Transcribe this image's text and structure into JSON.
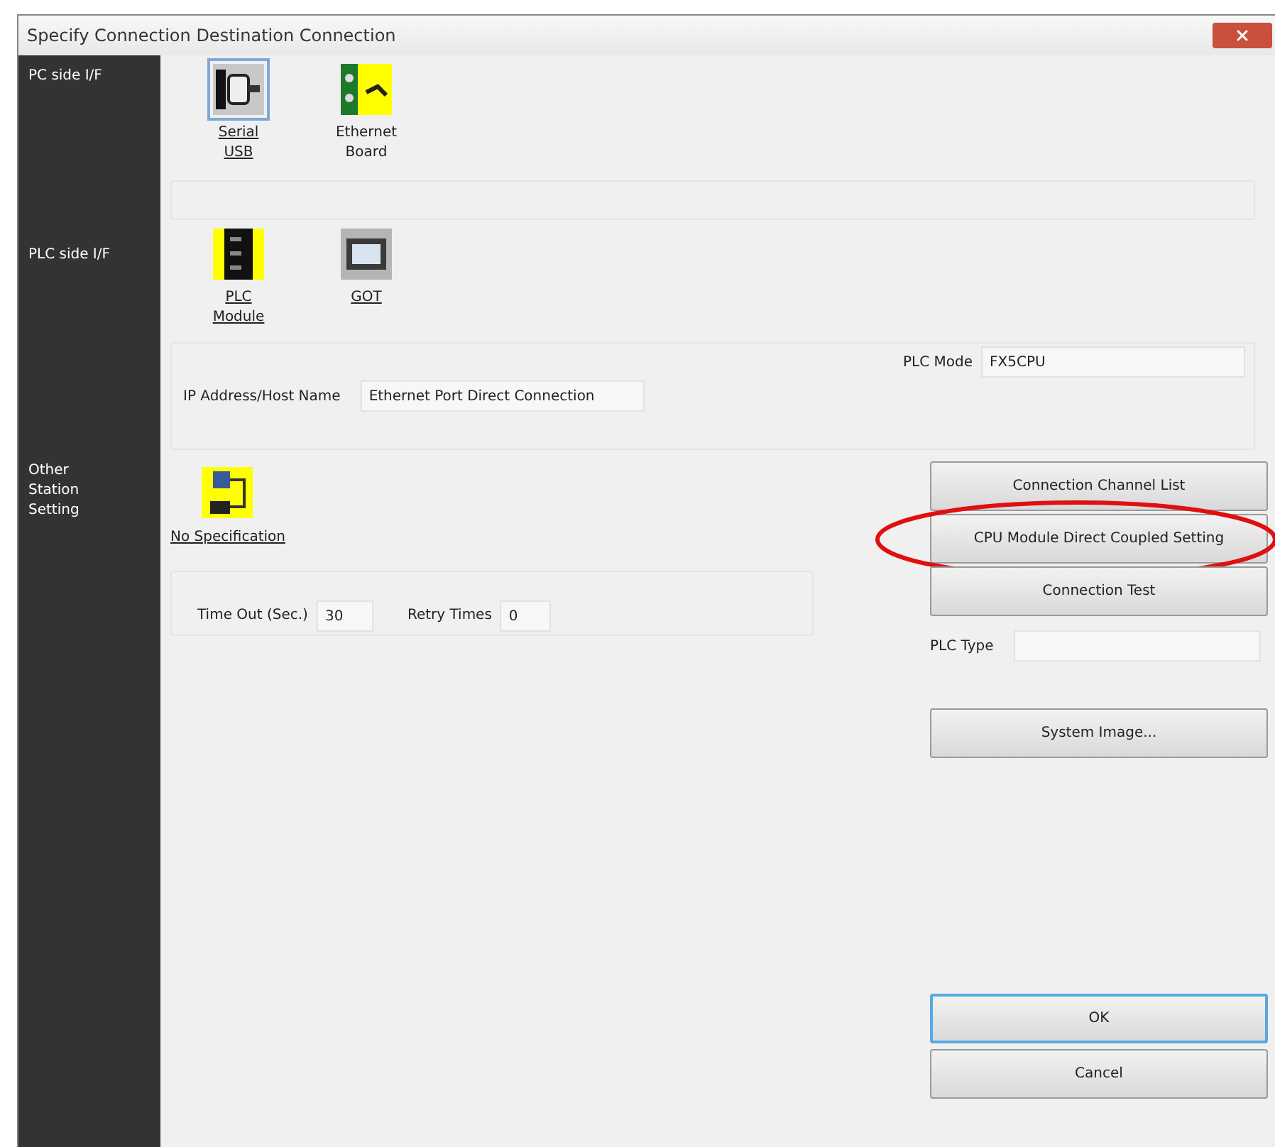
{
  "window": {
    "title": "Specify Connection Destination Connection"
  },
  "sidebar": {
    "sections": [
      "PC side I/F",
      "PLC side I/F",
      "Other Station Setting"
    ]
  },
  "pc_side": {
    "options": [
      {
        "kind": "serial",
        "label": "Serial USB",
        "selected": true,
        "link": true
      },
      {
        "kind": "ethernet",
        "label": "Ethernet Board",
        "selected": false,
        "link": false
      }
    ]
  },
  "plc_side": {
    "options": [
      {
        "kind": "plc",
        "label": "PLC Module",
        "selected": false,
        "link": true
      },
      {
        "kind": "got",
        "label": "GOT",
        "selected": false,
        "link": true
      }
    ],
    "plc_mode": {
      "label": "PLC Mode",
      "value": "FX5CPU"
    },
    "ip_address": {
      "label": "IP Address/Host Name",
      "value": "Ethernet Port Direct Connection"
    }
  },
  "other_station": {
    "option": {
      "kind": "station",
      "label": "No Specification",
      "link": true
    },
    "timeout": {
      "label": "Time Out (Sec.)",
      "value": "30"
    },
    "retry": {
      "label": "Retry Times",
      "value": "0"
    }
  },
  "buttons": [
    {
      "label": "Connection Channel List",
      "default": false,
      "highlighted": false
    },
    {
      "label": "CPU Module Direct Coupled Setting",
      "default": false,
      "highlighted": true
    },
    {
      "label": "Connection Test",
      "default": false,
      "highlighted": false
    }
  ],
  "plc_type": {
    "label": "PLC Type"
  },
  "system_image": {
    "label": "System Image...",
    "default": false
  },
  "footer_buttons": [
    {
      "label": "OK",
      "default": true
    },
    {
      "label": "Cancel",
      "default": false
    }
  ]
}
